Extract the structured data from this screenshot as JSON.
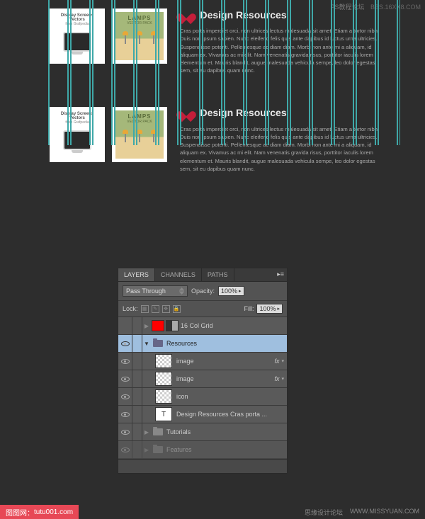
{
  "watermarks": {
    "top_left": "PS教程论坛",
    "top_right": "BBS.16XX8.COM"
  },
  "section": {
    "thumb1_title": "Display Screens Vectors",
    "thumb1_sub": "from Grafpedia",
    "thumb2_title": "LAMPS",
    "thumb2_sub": "VECTOR PACK",
    "heading": "Design Resources",
    "body": "Cras porta imperdiet orci, non ultrices lectus malesuada sit amet. Etiam a tortor nibh. Duis non ipsum sapien. Nunc eleifend felis quis ante dapibus id luctus urna ultricies. Suspendisse potenti. Pellentesque ac diam diam. Morbi non ante mi a aliquam, id aliquam ex. Vivamus ac mi elit. Nam venenatis gravida risus, porttitor iaculis lorem elementum et. Mauris blandit, augue malesuada vehicula sempe, leo dolor egestas sem, sit eu dapibus quam nunc."
  },
  "panel": {
    "tabs": [
      "LAYERS",
      "CHANNELS",
      "PATHS"
    ],
    "blend_mode": "Pass Through",
    "opacity_label": "Opacity:",
    "opacity_value": "100%",
    "lock_label": "Lock:",
    "fill_label": "Fill:",
    "fill_value": "100%",
    "layers": [
      {
        "name": "16 Col Grid"
      },
      {
        "name": "Resources"
      },
      {
        "name": "image"
      },
      {
        "name": "image"
      },
      {
        "name": "icon"
      },
      {
        "name": "Design Resources  Cras porta ..."
      },
      {
        "name": "Tutorials"
      },
      {
        "name": "Features"
      }
    ]
  },
  "footer": {
    "left_label": "图图网：",
    "left_url": "tutu001.com",
    "right1": "思缘设计论坛",
    "right2": "WWW.MISSYUAN.COM"
  }
}
